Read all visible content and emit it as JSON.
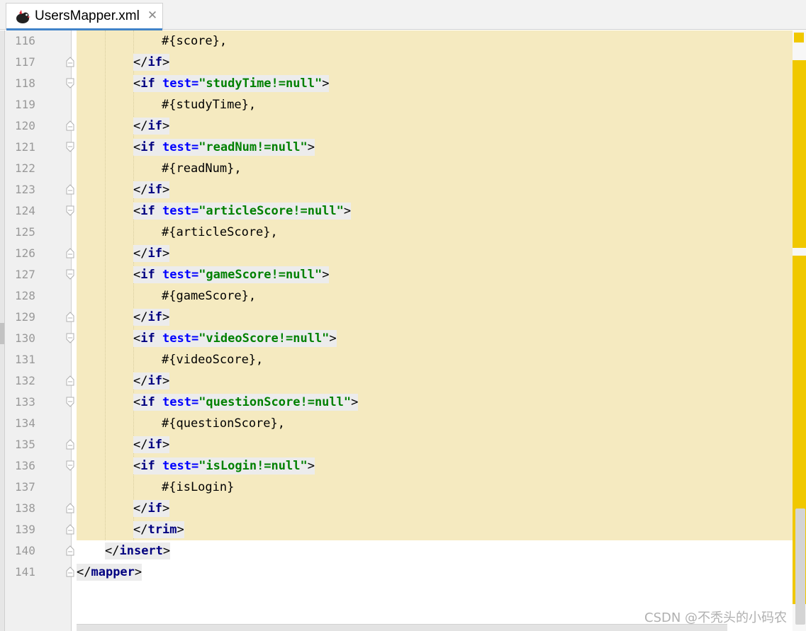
{
  "tab": {
    "title": "UsersMapper.xml",
    "close_glyph": "✕",
    "icon": "xml-file-icon"
  },
  "editor": {
    "lines": [
      {
        "num": "116",
        "indent": 3,
        "kind": "text",
        "text": "#{score},"
      },
      {
        "num": "117",
        "indent": 2,
        "kind": "close",
        "tag": "if"
      },
      {
        "num": "118",
        "indent": 2,
        "kind": "open",
        "tag": "if",
        "attr": "test",
        "value": "\"studyTime!=null\""
      },
      {
        "num": "119",
        "indent": 3,
        "kind": "text",
        "text": "#{studyTime},"
      },
      {
        "num": "120",
        "indent": 2,
        "kind": "close",
        "tag": "if"
      },
      {
        "num": "121",
        "indent": 2,
        "kind": "open",
        "tag": "if",
        "attr": "test",
        "value": "\"readNum!=null\""
      },
      {
        "num": "122",
        "indent": 3,
        "kind": "text",
        "text": "#{readNum},"
      },
      {
        "num": "123",
        "indent": 2,
        "kind": "close",
        "tag": "if"
      },
      {
        "num": "124",
        "indent": 2,
        "kind": "open",
        "tag": "if",
        "attr": "test",
        "value": "\"articleScore!=null\""
      },
      {
        "num": "125",
        "indent": 3,
        "kind": "text",
        "text": "#{articleScore},"
      },
      {
        "num": "126",
        "indent": 2,
        "kind": "close",
        "tag": "if"
      },
      {
        "num": "127",
        "indent": 2,
        "kind": "open",
        "tag": "if",
        "attr": "test",
        "value": "\"gameScore!=null\""
      },
      {
        "num": "128",
        "indent": 3,
        "kind": "text",
        "text": "#{gameScore},"
      },
      {
        "num": "129",
        "indent": 2,
        "kind": "close",
        "tag": "if"
      },
      {
        "num": "130",
        "indent": 2,
        "kind": "open",
        "tag": "if",
        "attr": "test",
        "value": "\"videoScore!=null\""
      },
      {
        "num": "131",
        "indent": 3,
        "kind": "text",
        "text": "#{videoScore},"
      },
      {
        "num": "132",
        "indent": 2,
        "kind": "close",
        "tag": "if"
      },
      {
        "num": "133",
        "indent": 2,
        "kind": "open",
        "tag": "if",
        "attr": "test",
        "value": "\"questionScore!=null\""
      },
      {
        "num": "134",
        "indent": 3,
        "kind": "text",
        "text": "#{questionScore},"
      },
      {
        "num": "135",
        "indent": 2,
        "kind": "close",
        "tag": "if"
      },
      {
        "num": "136",
        "indent": 2,
        "kind": "open",
        "tag": "if",
        "attr": "test",
        "value": "\"isLogin!=null\""
      },
      {
        "num": "137",
        "indent": 3,
        "kind": "text",
        "text": "#{isLogin}"
      },
      {
        "num": "138",
        "indent": 2,
        "kind": "close",
        "tag": "if"
      },
      {
        "num": "139",
        "indent": 2,
        "kind": "close",
        "tag": "trim"
      },
      {
        "num": "140",
        "indent": 1,
        "kind": "close",
        "tag": "insert"
      },
      {
        "num": "141",
        "indent": 0,
        "kind": "close",
        "tag": "mapper"
      }
    ]
  },
  "colors": {
    "highlight": "#f5eac0",
    "tag": "#000080",
    "attribute": "#0000ff",
    "string": "#008000",
    "marker": "#f0c800",
    "tab_accent": "#4083c9"
  },
  "watermark": "CSDN @不秃头的小码农"
}
